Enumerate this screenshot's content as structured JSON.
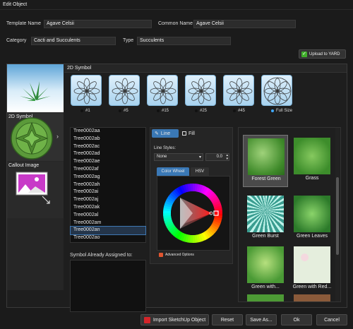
{
  "window": {
    "title": "Edit Object"
  },
  "form": {
    "template_name_label": "Template Name",
    "template_name_value": "Agave Celsii",
    "common_name_label": "Common Name",
    "common_name_value": "Agave Celsii",
    "category_label": "Category",
    "category_value": "Cacti and Succulents",
    "type_label": "Type",
    "type_value": "Succulents",
    "upload_label": "Upload to YARD"
  },
  "left_panel": {
    "tab_2d_symbol": "2D Symbol",
    "tab_callout": "Callout Image"
  },
  "symbol_section": {
    "header": "2D Symbol",
    "options": [
      {
        "label": "#1",
        "selected": false
      },
      {
        "label": "#5",
        "selected": false
      },
      {
        "label": "#15",
        "selected": false
      },
      {
        "label": "#25",
        "selected": false
      },
      {
        "label": "#45",
        "selected": false
      },
      {
        "label": "Full Size",
        "selected": true
      }
    ]
  },
  "tree_list": {
    "items": [
      "Tree0002aa",
      "Tree0002ab",
      "Tree0002ac",
      "Tree0002ad",
      "Tree0002ae",
      "Tree0002af",
      "Tree0002ag",
      "Tree0002ah",
      "Tree0002ai",
      "Tree0002aj",
      "Tree0002ak",
      "Tree0002al",
      "Tree0002am",
      "Tree0002an",
      "Tree0002ao"
    ],
    "selected_index": 13,
    "assigned_label": "Symbol Already Assigned to:"
  },
  "style_panel": {
    "tab_line": "Line",
    "tab_fill": "Fill",
    "line_styles_label": "Line Styles:",
    "line_style_value": "None",
    "line_width_value": "0.0",
    "tab_color_wheel": "Color Wheel",
    "tab_hsv": "HSV",
    "advanced_label": "Advanced Options"
  },
  "textures": [
    {
      "label": "Forest Green",
      "selected": true
    },
    {
      "label": "Grass",
      "selected": false
    },
    {
      "label": "Green Burst",
      "selected": false
    },
    {
      "label": "Green Leaves",
      "selected": false
    },
    {
      "label": "Green with...",
      "selected": false
    },
    {
      "label": "Green with Red...",
      "selected": false
    }
  ],
  "footer": {
    "import_label": "Import SketchUp Object",
    "reset_label": "Reset",
    "save_as_label": "Save As...",
    "ok_label": "Ok",
    "cancel_label": "Cancel"
  },
  "colors": {
    "accent": "#40a9ff",
    "upload_green": "#3fae2a",
    "selected_row": "#24354a"
  }
}
